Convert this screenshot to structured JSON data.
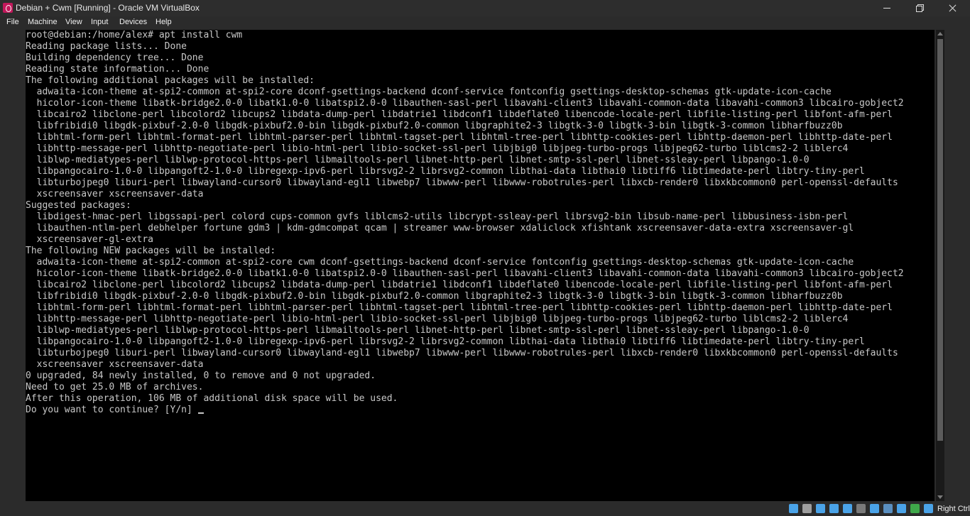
{
  "window": {
    "title": "Debian + Cwm [Running] - Oracle VM VirtualBox"
  },
  "menu": {
    "items": [
      "File",
      "Machine",
      "View",
      "Input",
      "Devices",
      "Help"
    ]
  },
  "terminal": {
    "lines": [
      "root@debian:/home/alex# apt install cwm",
      "Reading package lists... Done",
      "Building dependency tree... Done",
      "Reading state information... Done",
      "The following additional packages will be installed:",
      "  adwaita-icon-theme at-spi2-common at-spi2-core dconf-gsettings-backend dconf-service fontconfig gsettings-desktop-schemas gtk-update-icon-cache",
      "  hicolor-icon-theme libatk-bridge2.0-0 libatk1.0-0 libatspi2.0-0 libauthen-sasl-perl libavahi-client3 libavahi-common-data libavahi-common3 libcairo-gobject2",
      "  libcairo2 libclone-perl libcolord2 libcups2 libdata-dump-perl libdatrie1 libdconf1 libdeflate0 libencode-locale-perl libfile-listing-perl libfont-afm-perl",
      "  libfribidi0 libgdk-pixbuf-2.0-0 libgdk-pixbuf2.0-bin libgdk-pixbuf2.0-common libgraphite2-3 libgtk-3-0 libgtk-3-bin libgtk-3-common libharfbuzz0b",
      "  libhtml-form-perl libhtml-format-perl libhtml-parser-perl libhtml-tagset-perl libhtml-tree-perl libhttp-cookies-perl libhttp-daemon-perl libhttp-date-perl",
      "  libhttp-message-perl libhttp-negotiate-perl libio-html-perl libio-socket-ssl-perl libjbig0 libjpeg-turbo-progs libjpeg62-turbo liblcms2-2 liblerc4",
      "  liblwp-mediatypes-perl liblwp-protocol-https-perl libmailtools-perl libnet-http-perl libnet-smtp-ssl-perl libnet-ssleay-perl libpango-1.0-0",
      "  libpangocairo-1.0-0 libpangoft2-1.0-0 libregexp-ipv6-perl librsvg2-2 librsvg2-common libthai-data libthai0 libtiff6 libtimedate-perl libtry-tiny-perl",
      "  libturbojpeg0 liburi-perl libwayland-cursor0 libwayland-egl1 libwebp7 libwww-perl libwww-robotrules-perl libxcb-render0 libxkbcommon0 perl-openssl-defaults",
      "  xscreensaver xscreensaver-data",
      "Suggested packages:",
      "  libdigest-hmac-perl libgssapi-perl colord cups-common gvfs liblcms2-utils libcrypt-ssleay-perl librsvg2-bin libsub-name-perl libbusiness-isbn-perl",
      "  libauthen-ntlm-perl debhelper fortune gdm3 | kdm-gdmcompat qcam | streamer www-browser xdaliclock xfishtank xscreensaver-data-extra xscreensaver-gl",
      "  xscreensaver-gl-extra",
      "The following NEW packages will be installed:",
      "  adwaita-icon-theme at-spi2-common at-spi2-core cwm dconf-gsettings-backend dconf-service fontconfig gsettings-desktop-schemas gtk-update-icon-cache",
      "  hicolor-icon-theme libatk-bridge2.0-0 libatk1.0-0 libatspi2.0-0 libauthen-sasl-perl libavahi-client3 libavahi-common-data libavahi-common3 libcairo-gobject2",
      "  libcairo2 libclone-perl libcolord2 libcups2 libdata-dump-perl libdatrie1 libdconf1 libdeflate0 libencode-locale-perl libfile-listing-perl libfont-afm-perl",
      "  libfribidi0 libgdk-pixbuf-2.0-0 libgdk-pixbuf2.0-bin libgdk-pixbuf2.0-common libgraphite2-3 libgtk-3-0 libgtk-3-bin libgtk-3-common libharfbuzz0b",
      "  libhtml-form-perl libhtml-format-perl libhtml-parser-perl libhtml-tagset-perl libhtml-tree-perl libhttp-cookies-perl libhttp-daemon-perl libhttp-date-perl",
      "  libhttp-message-perl libhttp-negotiate-perl libio-html-perl libio-socket-ssl-perl libjbig0 libjpeg-turbo-progs libjpeg62-turbo liblcms2-2 liblerc4",
      "  liblwp-mediatypes-perl liblwp-protocol-https-perl libmailtools-perl libnet-http-perl libnet-smtp-ssl-perl libnet-ssleay-perl libpango-1.0-0",
      "  libpangocairo-1.0-0 libpangoft2-1.0-0 libregexp-ipv6-perl librsvg2-2 librsvg2-common libthai-data libthai0 libtiff6 libtimedate-perl libtry-tiny-perl",
      "  libturbojpeg0 liburi-perl libwayland-cursor0 libwayland-egl1 libwebp7 libwww-perl libwww-robotrules-perl libxcb-render0 libxkbcommon0 perl-openssl-defaults",
      "  xscreensaver xscreensaver-data",
      "0 upgraded, 84 newly installed, 0 to remove and 0 not upgraded.",
      "Need to get 25.0 MB of archives.",
      "After this operation, 106 MB of additional disk space will be used.",
      "Do you want to continue? [Y/n] "
    ]
  },
  "statusbar": {
    "icons": [
      {
        "name": "hard-disk-icon",
        "color": "#4aa3e8"
      },
      {
        "name": "optical-drive-icon",
        "color": "#9e9e9e"
      },
      {
        "name": "audio-icon",
        "color": "#4aa3e8"
      },
      {
        "name": "network-icon",
        "color": "#4aa3e8"
      },
      {
        "name": "usb-icon",
        "color": "#4aa3e8"
      },
      {
        "name": "shared-folder-icon",
        "color": "#7a7a7a"
      },
      {
        "name": "display-icon",
        "color": "#4aa3e8"
      },
      {
        "name": "video-capture-icon",
        "color": "#5a8fc0"
      },
      {
        "name": "graphics-icon",
        "color": "#4aa3e8"
      },
      {
        "name": "cpu-icon",
        "color": "#3fa84a"
      },
      {
        "name": "mouse-integration-icon",
        "color": "#4aa3e8"
      }
    ],
    "host_key": "Right Ctrl"
  }
}
